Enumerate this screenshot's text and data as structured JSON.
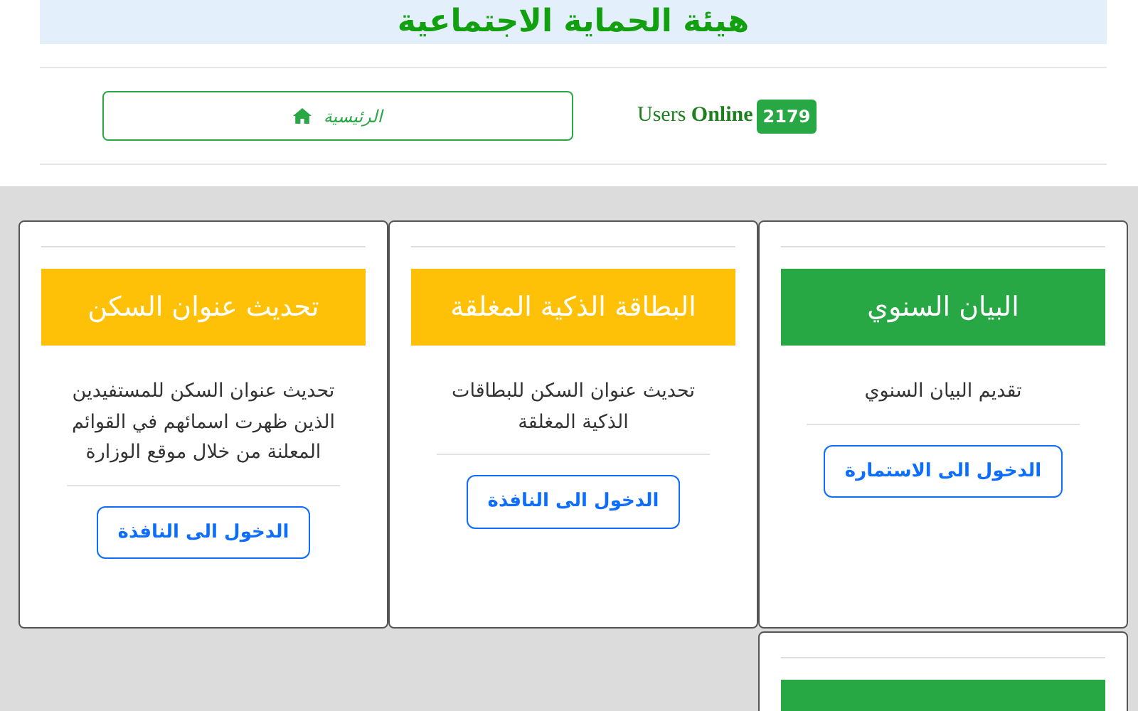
{
  "header": {
    "title": "هيئة الحماية الاجتماعية"
  },
  "nav": {
    "home_link": "الرئيسية",
    "users_online": "Users **Online**",
    "online_count": "2179"
  },
  "cards": [
    {
      "title": "البيان السنوي",
      "color": "#28a745",
      "description": "تقديم البيان السنوي",
      "button": "الدخول الى الاستمارة"
    },
    {
      "title": "البطاقة الذكية المغلقة",
      "color": "#ffc107",
      "description": "تحديث عنوان السكن للبطاقات الذكية المغلقة",
      "button": "الدخول الى النافذة"
    },
    {
      "title": "تحديث عنوان السكن",
      "color": "#ffc107",
      "description": "تحديث عنوان السكن للمستفيدين الذين ظهرت اسمائهم في القوائم المعلنة من خلال موقع الوزارة",
      "button": "الدخول الى النافذة"
    },
    {
      "color": "#28a745"
    }
  ]
}
